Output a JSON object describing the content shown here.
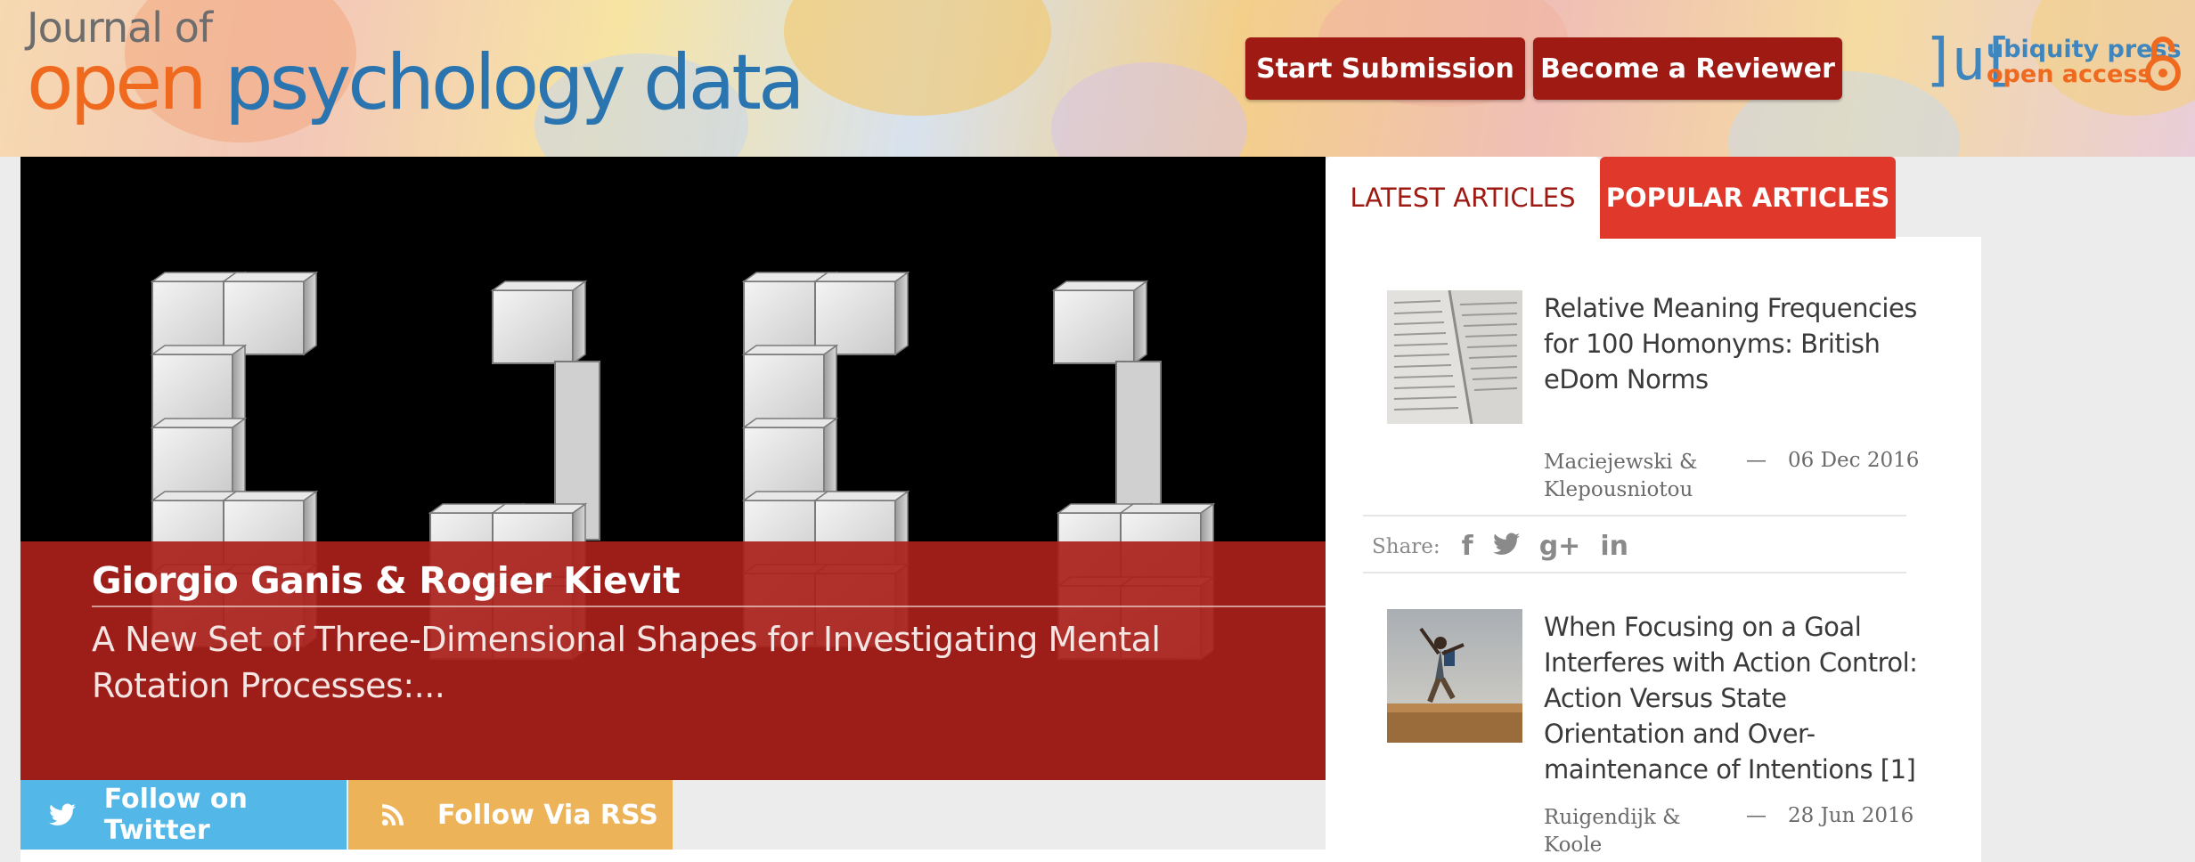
{
  "header": {
    "logo": {
      "line1": "Journal of",
      "word_open": "open",
      "word_rest": "psychology data"
    },
    "buttons": {
      "start_submission": "Start Submission",
      "become_reviewer": "Become a Reviewer"
    },
    "publisher": {
      "brackets": "]u[",
      "line1": "ubiquity press",
      "line2": "open access",
      "icon": "open-access-lock-icon"
    }
  },
  "hero": {
    "authors": "Giorgio Ganis & Rogier Kievit",
    "title": "A New Set of Three-Dimensional Shapes for Investigating Mental Rotation Processes:..."
  },
  "follow": {
    "twitter": {
      "label": "Follow on Twitter",
      "icon": "twitter-icon"
    },
    "rss": {
      "label": "Follow Via RSS",
      "icon": "rss-icon"
    }
  },
  "tabs": {
    "latest": "LATEST ARTICLES",
    "popular": "POPULAR ARTICLES"
  },
  "articles": [
    {
      "title": "Relative Meaning Frequencies for 100 Homonyms: British eDom Norms",
      "authors": "Maciejewski & Klepousniotou",
      "dash": "—",
      "date": "06 Dec 2016",
      "thumbnail": "dictionary-page-image"
    },
    {
      "title": "When Focusing on a Goal Interferes with Action Control: Action Versus State Orientation and Over-maintenance of Intentions [1]",
      "authors": "Ruigendijk & Koole",
      "dash": "—",
      "date": "28 Jun 2016",
      "thumbnail": "jumping-person-image"
    }
  ],
  "share": {
    "label": "Share:",
    "facebook": "f",
    "google_plus": "g+",
    "linkedin": "in",
    "icons": [
      "facebook-icon",
      "twitter-icon",
      "google-plus-icon",
      "linkedin-icon"
    ]
  },
  "colors": {
    "brand_red": "#9e1a13",
    "tab_red": "#e0392b",
    "overlay_red": "#aa201a",
    "twitter_blue": "#53b8e8",
    "rss_orange": "#ecb359",
    "logo_orange": "#ef6a1f",
    "logo_blue": "#2a74b0"
  }
}
